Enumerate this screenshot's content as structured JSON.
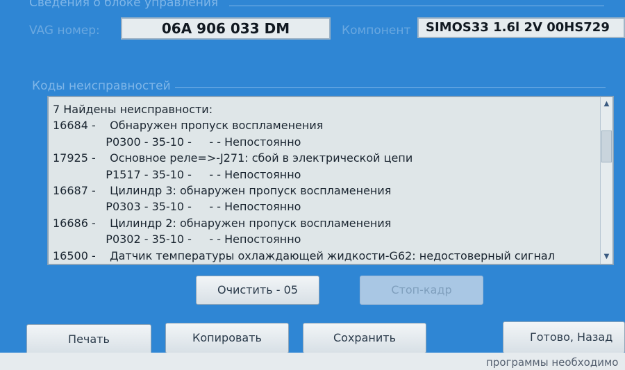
{
  "controller_group": {
    "title": "Сведения о блоке управления",
    "vag_label": "VAG номер:",
    "vag_value": "06A 906 033 DM",
    "component_label": "Компонент",
    "component_value": "SIMOS33 1.6l 2V 00HS729"
  },
  "fault_group": {
    "title": "Коды неисправностей",
    "lines": [
      "7 Найдены неисправности:",
      "16684 -    Обнаружен пропуск воспламенения",
      "               P0300 - 35-10 -     - - Непостоянно",
      "17925 -    Основное реле=>-J271: сбой в электрической цепи",
      "               P1517 - 35-10 -     - - Непостоянно",
      "16687 -    Цилиндр 3: обнаружен пропуск воспламенения",
      "               P0303 - 35-10 -     - - Непостоянно",
      "16686 -    Цилиндр 2: обнаружен пропуск воспламенения",
      "               P0302 - 35-10 -     - - Непостоянно",
      "16500 -    Датчик температуры охлаждающей жидкости-G62: недостоверный сигнал"
    ]
  },
  "buttons": {
    "clear": "Очистить - 05",
    "freeze_frame": "Стоп-кадр",
    "print": "Печать",
    "copy": "Копировать",
    "save": "Сохранить",
    "done": "Готово, Назад"
  },
  "footer_text": "программы необходимо"
}
